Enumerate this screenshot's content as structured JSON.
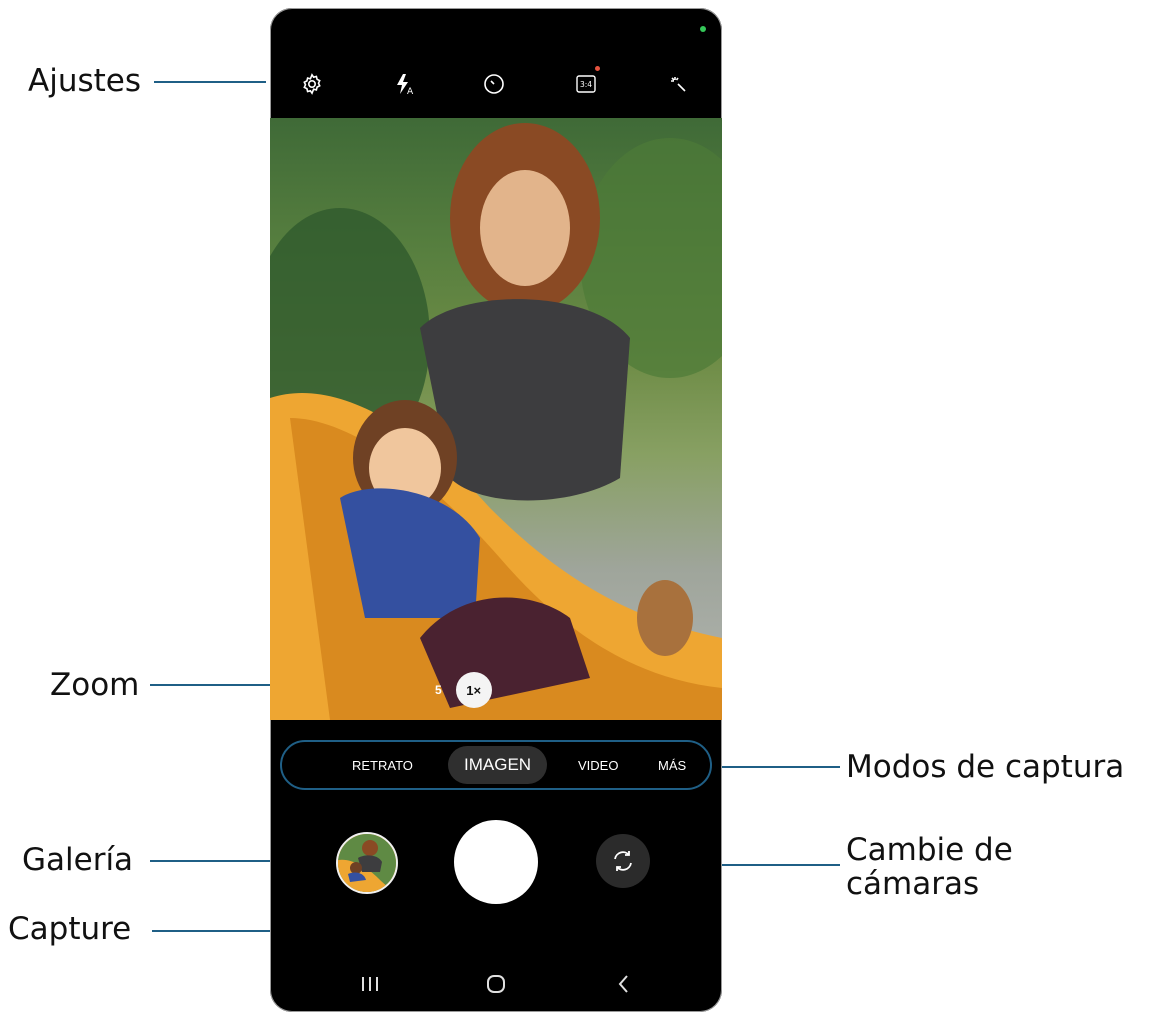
{
  "callouts": {
    "settings": "Ajustes",
    "zoom": "Zoom",
    "shooting_modes": "Modos de captura",
    "gallery": "Galería",
    "switch_cameras": "Cambie de\ncámaras",
    "capture": "Capture"
  },
  "camera": {
    "top_icons": [
      "settings-gear-icon",
      "flash-auto-icon",
      "timer-icon",
      "aspect-ratio-icon",
      "effects-icon"
    ],
    "aspect_ratio": "3:4",
    "zoom": {
      "secondary": "5",
      "active": "1×"
    },
    "modes": [
      "RETRATO",
      "IMAGEN",
      "VIDEO",
      "MÁS"
    ],
    "active_mode": "IMAGEN"
  },
  "navbar": {
    "icons": [
      "recent-apps-icon",
      "home-icon",
      "back-icon"
    ]
  },
  "colors": {
    "callout_line": "#1f5f86",
    "phone_bg": "#000000",
    "status_dot": "#35c759",
    "notification_dot": "#e5533f"
  }
}
